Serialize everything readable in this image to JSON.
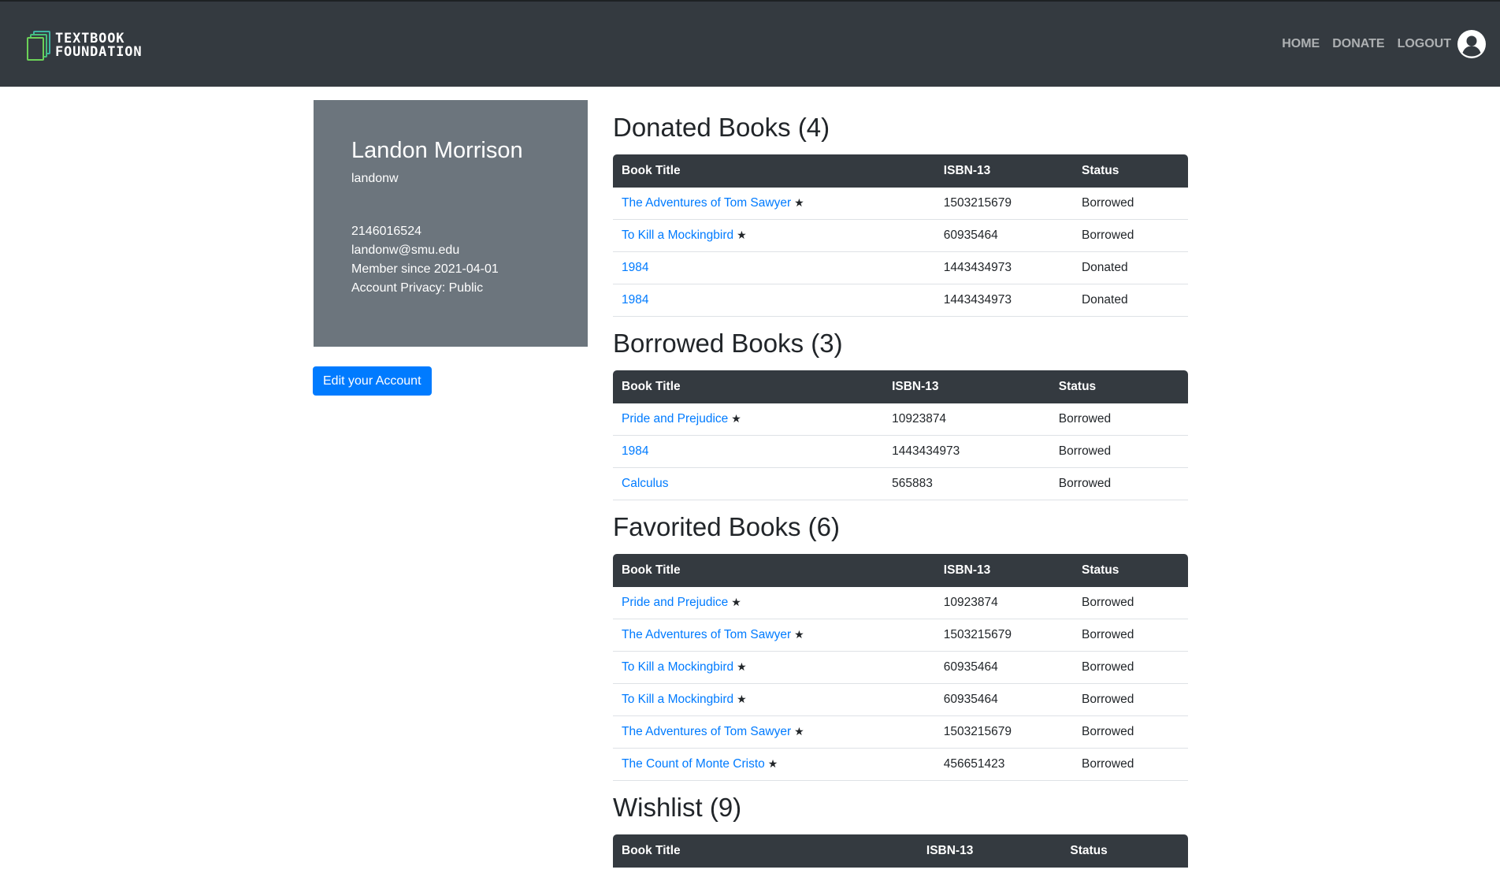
{
  "brand": {
    "line1": "TEXTBOOK",
    "line2": "FOUNDATION"
  },
  "nav": {
    "home": "HOME",
    "donate": "DONATE",
    "logout": "LOGOUT"
  },
  "profile": {
    "name": "Landon Morrison",
    "username": "landonw",
    "phone": "2146016524",
    "email": "landonw@smu.edu",
    "member_since": "Member since 2021-04-01",
    "privacy": "Account Privacy: Public",
    "edit_button": "Edit your Account"
  },
  "columns": {
    "title": "Book Title",
    "isbn": "ISBN-13",
    "status": "Status"
  },
  "star_glyph": "★",
  "sections": [
    {
      "title": "Donated Books (4)",
      "rows": [
        {
          "title": "The Adventures of Tom Sawyer",
          "starred": true,
          "isbn": "1503215679",
          "status": "Borrowed"
        },
        {
          "title": "To Kill a Mockingbird",
          "starred": true,
          "isbn": "60935464",
          "status": "Borrowed"
        },
        {
          "title": "1984",
          "starred": false,
          "isbn": "1443434973",
          "status": "Donated"
        },
        {
          "title": "1984",
          "starred": false,
          "isbn": "1443434973",
          "status": "Donated"
        }
      ]
    },
    {
      "title": "Borrowed Books (3)",
      "rows": [
        {
          "title": "Pride and Prejudice",
          "starred": true,
          "isbn": "10923874",
          "status": "Borrowed"
        },
        {
          "title": "1984",
          "starred": false,
          "isbn": "1443434973",
          "status": "Borrowed"
        },
        {
          "title": "Calculus",
          "starred": false,
          "isbn": "565883",
          "status": "Borrowed"
        }
      ]
    },
    {
      "title": "Favorited Books (6)",
      "rows": [
        {
          "title": "Pride and Prejudice",
          "starred": true,
          "isbn": "10923874",
          "status": "Borrowed"
        },
        {
          "title": "The Adventures of Tom Sawyer",
          "starred": true,
          "isbn": "1503215679",
          "status": "Borrowed"
        },
        {
          "title": "To Kill a Mockingbird",
          "starred": true,
          "isbn": "60935464",
          "status": "Borrowed"
        },
        {
          "title": "To Kill a Mockingbird",
          "starred": true,
          "isbn": "60935464",
          "status": "Borrowed"
        },
        {
          "title": "The Adventures of Tom Sawyer",
          "starred": true,
          "isbn": "1503215679",
          "status": "Borrowed"
        },
        {
          "title": "The Count of Monte Cristo",
          "starred": true,
          "isbn": "456651423",
          "status": "Borrowed"
        }
      ]
    },
    {
      "title": "Wishlist (9)",
      "rows": []
    }
  ]
}
